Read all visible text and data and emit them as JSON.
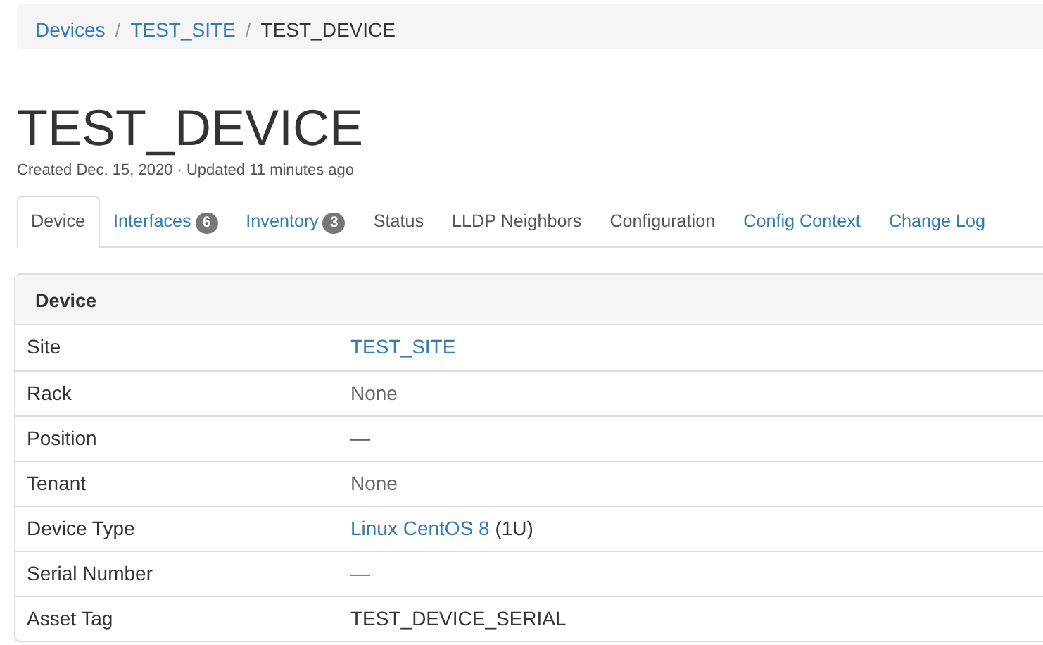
{
  "breadcrumb_separator": "/",
  "breadcrumb": [
    {
      "label": "Devices",
      "kind": "link"
    },
    {
      "label": "TEST_SITE",
      "kind": "link"
    },
    {
      "label": "TEST_DEVICE",
      "kind": "current"
    }
  ],
  "title": "TEST_DEVICE",
  "meta": "Created Dec. 15, 2020 · Updated 11 minutes ago",
  "tabs": [
    {
      "label": "Device",
      "selected": true,
      "kind": "link"
    },
    {
      "label": "Interfaces",
      "badge": "6",
      "selected": false,
      "kind": "link"
    },
    {
      "label": "Inventory",
      "badge": "3",
      "selected": false,
      "kind": "link"
    },
    {
      "label": "Status",
      "selected": false,
      "kind": "plain"
    },
    {
      "label": "LLDP Neighbors",
      "selected": false,
      "kind": "plain"
    },
    {
      "label": "Configuration",
      "selected": false,
      "kind": "plain"
    },
    {
      "label": "Config Context",
      "selected": false,
      "kind": "link"
    },
    {
      "label": "Change Log",
      "selected": false,
      "kind": "link"
    }
  ],
  "panel": {
    "heading": "Device",
    "rows": [
      {
        "label": "Site",
        "value": "TEST_SITE",
        "kind": "link"
      },
      {
        "label": "Rack",
        "value": "None",
        "kind": "muted"
      },
      {
        "label": "Position",
        "value": "—",
        "kind": "muted"
      },
      {
        "label": "Tenant",
        "value": "None",
        "kind": "muted"
      },
      {
        "label": "Device Type",
        "value": "Linux CentOS 8",
        "suffix": "(1U)",
        "kind": "link"
      },
      {
        "label": "Serial Number",
        "value": "—",
        "kind": "muted"
      },
      {
        "label": "Asset Tag",
        "value": "TEST_DEVICE_SERIAL",
        "kind": "plain"
      }
    ]
  }
}
